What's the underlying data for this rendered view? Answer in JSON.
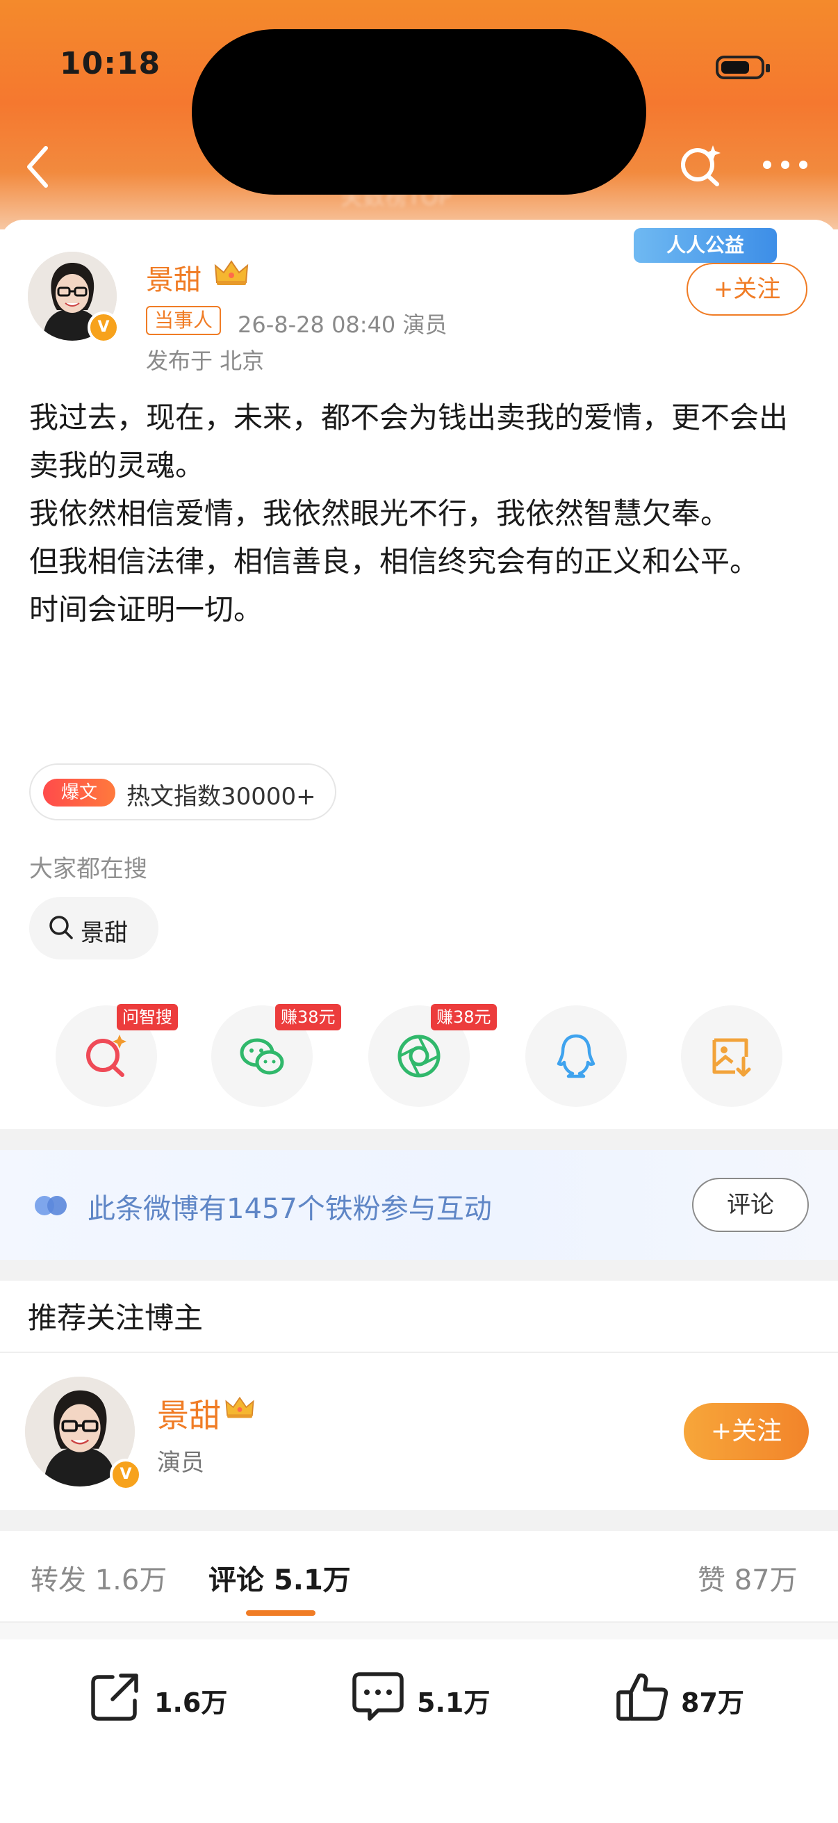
{
  "status_bar": {
    "time": "10:18"
  },
  "header": {
    "blurred_subtitle": "关数榜TOP",
    "icons": [
      "back-arrow-icon",
      "ai-search-icon",
      "more-icon"
    ]
  },
  "post": {
    "author": "景甜",
    "role_tag": "当事人",
    "datetime_role": "26-8-28 08:40  演员",
    "location": "发布于 北京",
    "charity_label": "人人公益",
    "follow_label": "+关注",
    "paragraphs": [
      "我过去，现在，未来，都不会为钱出卖我的爱情，更不会出卖我的灵魂。",
      "我依然相信爱情，我依然眼光不行，我依然智慧欠奉。",
      "但我相信法律，相信善良，相信终究会有的正义和公平。",
      "时间会证明一切。"
    ],
    "hot_badge": "爆文",
    "hot_text": "热文指数30000+",
    "search_label": "大家都在搜",
    "search_chip": "景甜"
  },
  "share_row": {
    "badges": [
      "问智搜",
      "赚38元",
      "赚38元"
    ],
    "icons": [
      "ai-search-icon",
      "wechat-icon",
      "moments-icon",
      "qq-icon",
      "save-image-icon"
    ]
  },
  "fans": {
    "text": "此条微博有1457个铁粉参与互动",
    "button": "评论"
  },
  "recommend": {
    "title": "推荐关注博主",
    "name": "景甜",
    "role": "演员",
    "follow_label": "+关注"
  },
  "tabs": {
    "reposts": "转发 1.6万",
    "comments": "评论 5.1万",
    "likes": "赞 87万"
  },
  "actions": {
    "repost": "1.6万",
    "comment": "5.1万",
    "like": "87万"
  },
  "colors": {
    "brand_orange": "#f07c25",
    "header_orange": "#f5782f",
    "link_blue": "#5f86c6",
    "badge_red": "#ec3c3c"
  }
}
